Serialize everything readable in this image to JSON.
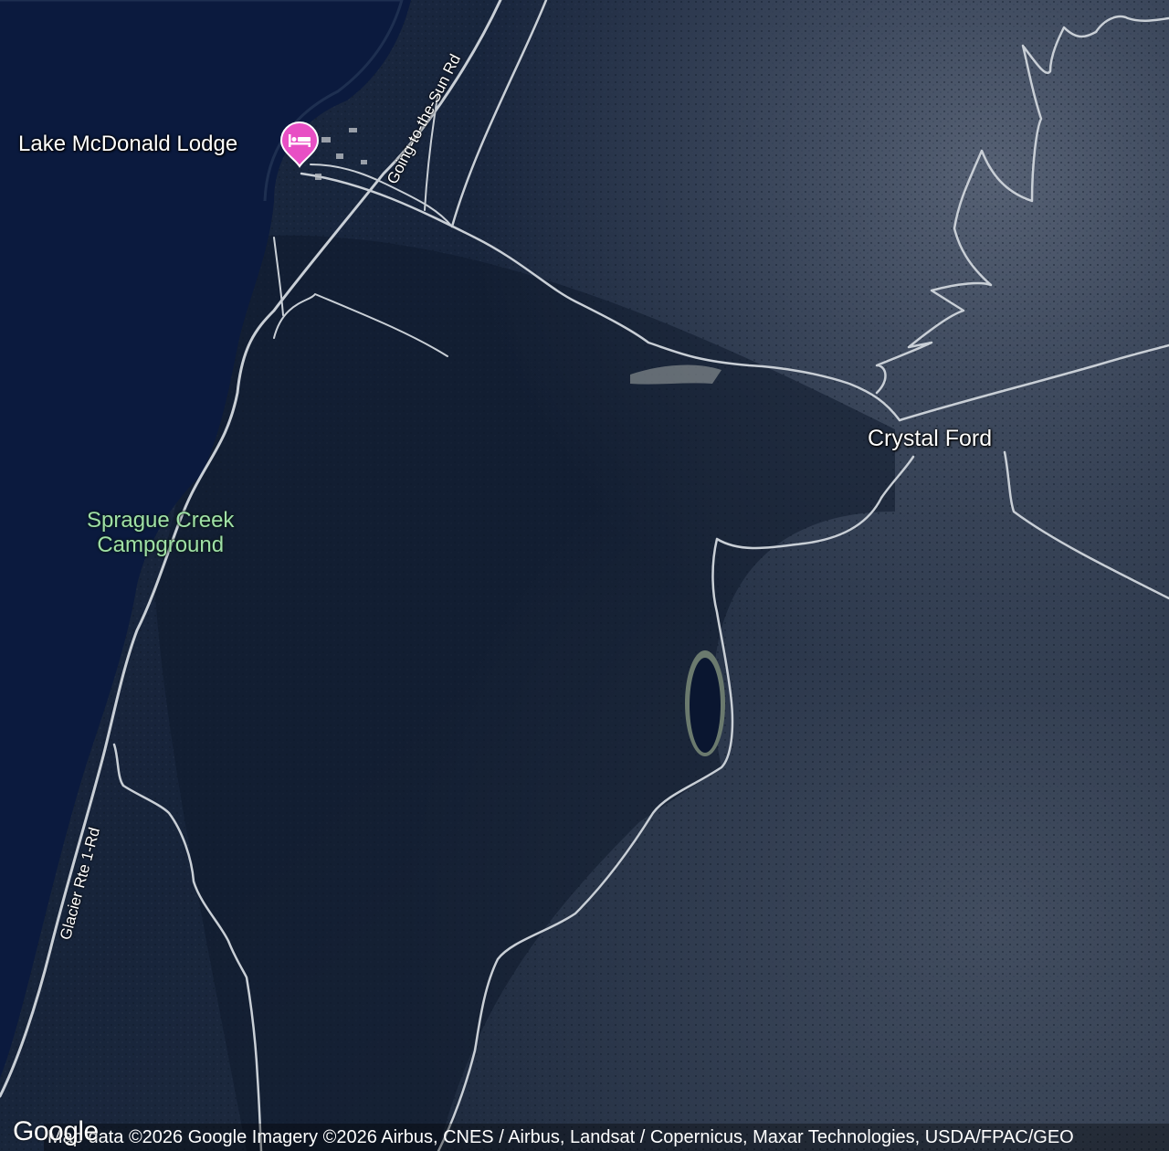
{
  "map": {
    "type": "satellite",
    "places": {
      "lodge": "Lake McDonald Lodge",
      "crystal_ford": "Crystal Ford",
      "campground_line1": "Sprague Creek",
      "campground_line2": "Campground"
    },
    "roads": {
      "going_to_the_sun": "Going-to-the-Sun Rd",
      "glacier_rte": "Glacier Rte 1-Rd"
    },
    "icons": {
      "lodge_marker": "hotel-bed-icon"
    },
    "colors": {
      "lake": "#0b1a3e",
      "forest": "#15233a",
      "lodging_marker": "#e84fc4",
      "campground_text": "#9fe0a6",
      "road": "#c9cfd6"
    }
  },
  "footer": {
    "logo": "Google",
    "attribution": "Map data ©2026 Google Imagery ©2026 Airbus, CNES / Airbus, Landsat / Copernicus, Maxar Technologies, USDA/FPAC/GEO"
  }
}
